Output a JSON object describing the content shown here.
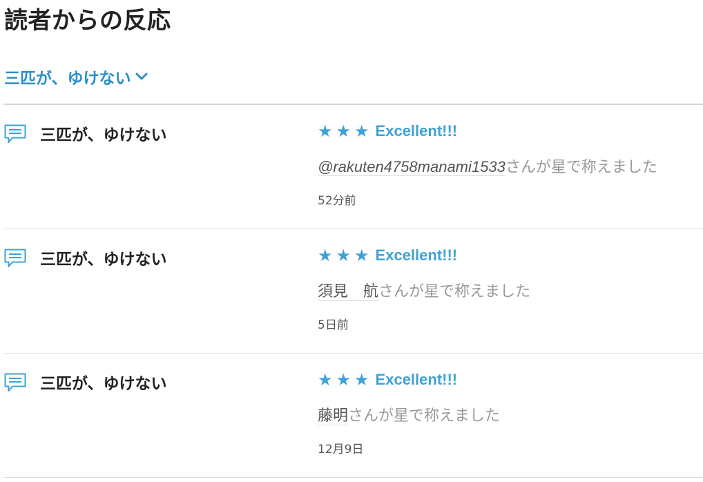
{
  "page": {
    "title": "読者からの反応"
  },
  "filter": {
    "label": "三匹が、ゆけない",
    "icon": "chevron-down-icon"
  },
  "colors": {
    "accent": "#3ea2d6",
    "link": "#2a8fc9"
  },
  "reactions": [
    {
      "entry_title": "三匹が、ゆけない",
      "stars": "★★★",
      "star_count": 3,
      "rating_label": "Excellent!!!",
      "user": "@rakuten4758manami1533",
      "action_text": "さんが星で称えました",
      "time": "52分前",
      "icon": "comment-icon"
    },
    {
      "entry_title": "三匹が、ゆけない",
      "stars": "★★★",
      "star_count": 3,
      "rating_label": "Excellent!!!",
      "user": "須見　航",
      "action_text": "さんが星で称えました",
      "time": "5日前",
      "icon": "comment-icon"
    },
    {
      "entry_title": "三匹が、ゆけない",
      "stars": "★★★",
      "star_count": 3,
      "rating_label": "Excellent!!!",
      "user": "藤明",
      "action_text": "さんが星で称えました",
      "time": "12月9日",
      "icon": "comment-icon"
    }
  ]
}
